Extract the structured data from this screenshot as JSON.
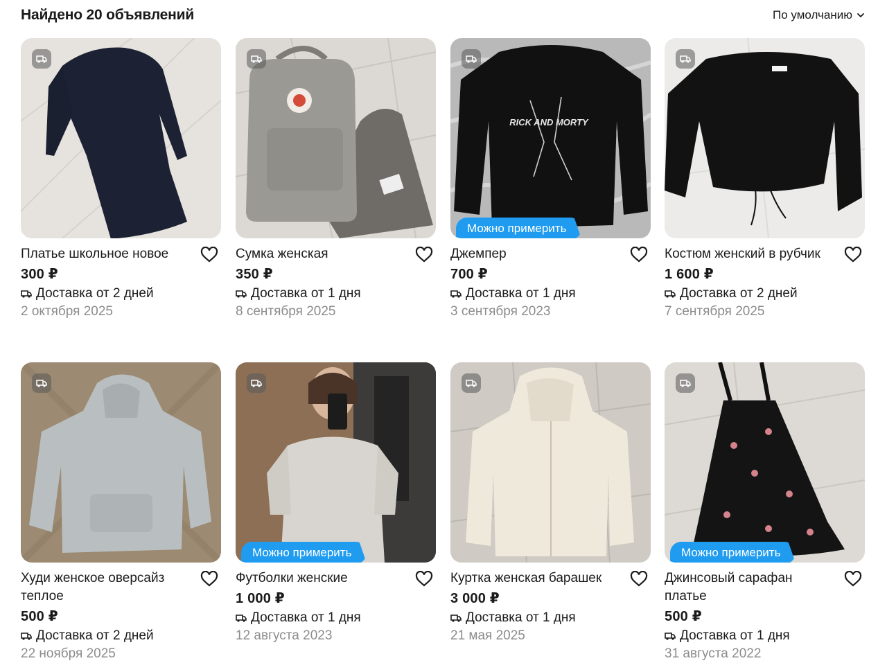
{
  "header": {
    "title": "Найдено 20 объявлений",
    "sort_label": "По умолчанию"
  },
  "colors": {
    "accent": "#1f9cf0",
    "muted": "#8c8c8c"
  },
  "badges": {
    "try_on": "Можно примерить"
  },
  "items": [
    {
      "title": "Платье школьное новое",
      "price": "300 ₽",
      "delivery": "Доставка от 2 дней",
      "date": "2 октября 2025",
      "try_on": false
    },
    {
      "title": "Сумка женская",
      "price": "350 ₽",
      "delivery": "Доставка от 1 дня",
      "date": "8 сентября 2025",
      "try_on": false
    },
    {
      "title": "Джемпер",
      "price": "700 ₽",
      "delivery": "Доставка от 1 дня",
      "date": "3 сентября 2023",
      "try_on": true,
      "print_text": "RICK AND MORTY"
    },
    {
      "title": "Костюм женский в рубчик",
      "price": "1 600 ₽",
      "delivery": "Доставка от 2 дней",
      "date": "7 сентября 2025",
      "try_on": false
    },
    {
      "title": "Худи женское оверсайз теплое",
      "price": "500 ₽",
      "delivery": "Доставка от 2 дней",
      "date": "22 ноября 2025",
      "try_on": false
    },
    {
      "title": "Футболки женские",
      "price": "1 000 ₽",
      "delivery": "Доставка от 1 дня",
      "date": "12 августа 2023",
      "try_on": true
    },
    {
      "title": "Куртка женская барашек",
      "price": "3 000 ₽",
      "delivery": "Доставка от 1 дня",
      "date": "21 мая 2025",
      "try_on": false
    },
    {
      "title": "Джинсовый сарафан платье",
      "price": "500 ₽",
      "delivery": "Доставка от 1 дня",
      "date": "31 августа 2022",
      "try_on": true
    }
  ]
}
